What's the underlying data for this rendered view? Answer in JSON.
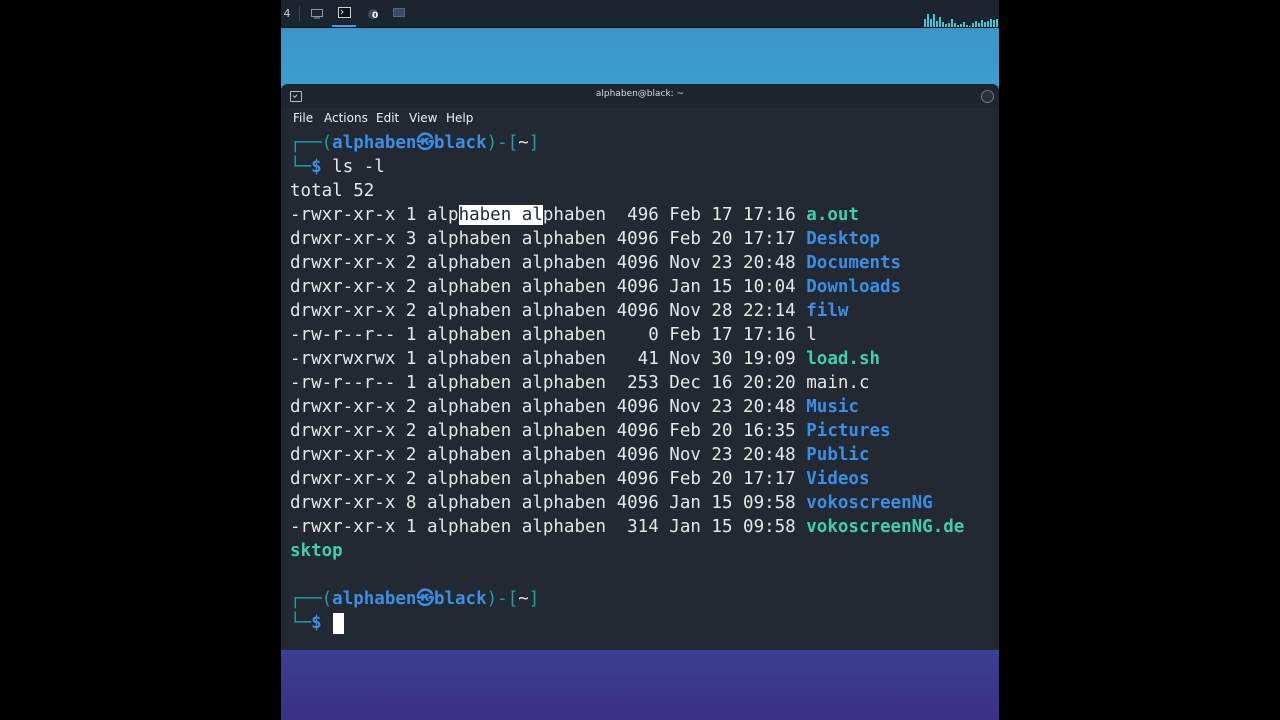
{
  "panel": {
    "workspace_number": "4",
    "tasks": [
      {
        "name": "desktop-icon",
        "active": false
      },
      {
        "name": "terminal-icon",
        "active": true
      },
      {
        "name": "record-icon",
        "badge": "0",
        "active": false
      },
      {
        "name": "screen-icon",
        "active": false
      }
    ],
    "cpu_graph_levels": [
      0.55,
      0.9,
      0.6,
      0.95,
      0.45,
      0.7,
      0.35,
      0.2,
      0.3,
      0.6,
      0.25,
      0.15,
      0.2,
      0.35,
      0.15,
      0.1,
      0.25,
      0.4,
      0.3,
      0.5,
      0.35,
      0.45,
      0.6,
      0.5,
      0.55
    ]
  },
  "window": {
    "title": "alphaben@black: ~",
    "menu": [
      "File",
      "Actions",
      "Edit",
      "View",
      "Help"
    ]
  },
  "terminal": {
    "prompt": {
      "open": "┌──(",
      "user": "alphaben",
      "at": "㉿",
      "host": "black",
      "close": ")-[",
      "dir": "~",
      "end": "]",
      "corner": "└─",
      "dollar": "$"
    },
    "command": " ls -l",
    "total": "total 52",
    "listing": [
      {
        "perm": "-rwxr-xr-x",
        "links": "1",
        "user": "alphaben",
        "group": "alphaben",
        "size": "496",
        "date": "Feb 17 17:16",
        "name": "a.out",
        "kind": "exec"
      },
      {
        "perm": "drwxr-xr-x",
        "links": "3",
        "user": "alphaben",
        "group": "alphaben",
        "size": "4096",
        "date": "Feb 20 17:17",
        "name": "Desktop",
        "kind": "dir"
      },
      {
        "perm": "drwxr-xr-x",
        "links": "2",
        "user": "alphaben",
        "group": "alphaben",
        "size": "4096",
        "date": "Nov 23 20:48",
        "name": "Documents",
        "kind": "dir"
      },
      {
        "perm": "drwxr-xr-x",
        "links": "2",
        "user": "alphaben",
        "group": "alphaben",
        "size": "4096",
        "date": "Jan 15 10:04",
        "name": "Downloads",
        "kind": "dir"
      },
      {
        "perm": "drwxr-xr-x",
        "links": "2",
        "user": "alphaben",
        "group": "alphaben",
        "size": "4096",
        "date": "Nov 28 22:14",
        "name": "filw",
        "kind": "dir"
      },
      {
        "perm": "-rw-r--r--",
        "links": "1",
        "user": "alphaben",
        "group": "alphaben",
        "size": "0",
        "date": "Feb 17 17:16",
        "name": "l",
        "kind": "file"
      },
      {
        "perm": "-rwxrwxrwx",
        "links": "1",
        "user": "alphaben",
        "group": "alphaben",
        "size": "41",
        "date": "Nov 30 19:09",
        "name": "load.sh",
        "kind": "exec"
      },
      {
        "perm": "-rw-r--r--",
        "links": "1",
        "user": "alphaben",
        "group": "alphaben",
        "size": "253",
        "date": "Dec 16 20:20",
        "name": "main.c",
        "kind": "file"
      },
      {
        "perm": "drwxr-xr-x",
        "links": "2",
        "user": "alphaben",
        "group": "alphaben",
        "size": "4096",
        "date": "Nov 23 20:48",
        "name": "Music",
        "kind": "dir"
      },
      {
        "perm": "drwxr-xr-x",
        "links": "2",
        "user": "alphaben",
        "group": "alphaben",
        "size": "4096",
        "date": "Feb 20 16:35",
        "name": "Pictures",
        "kind": "dir"
      },
      {
        "perm": "drwxr-xr-x",
        "links": "2",
        "user": "alphaben",
        "group": "alphaben",
        "size": "4096",
        "date": "Nov 23 20:48",
        "name": "Public",
        "kind": "dir"
      },
      {
        "perm": "drwxr-xr-x",
        "links": "2",
        "user": "alphaben",
        "group": "alphaben",
        "size": "4096",
        "date": "Feb 20 17:17",
        "name": "Videos",
        "kind": "dir"
      },
      {
        "perm": "drwxr-xr-x",
        "links": "8",
        "user": "alphaben",
        "group": "alphaben",
        "size": "4096",
        "date": "Jan 15 09:58",
        "name": "vokoscreenNG",
        "kind": "dir"
      },
      {
        "perm": "-rwxr-xr-x",
        "links": "1",
        "user": "alphaben",
        "group": "alphaben",
        "size": "314",
        "date": "Jan 15 09:58",
        "name": "vokoscreenNG.desktop",
        "kind": "exec"
      }
    ],
    "selection": "haben al",
    "colors": {
      "teal": "#17a3a6",
      "dir": "#3b8ee6",
      "exec": "#3fd0a8",
      "text": "#e6e6e6",
      "background": "#222932"
    }
  }
}
